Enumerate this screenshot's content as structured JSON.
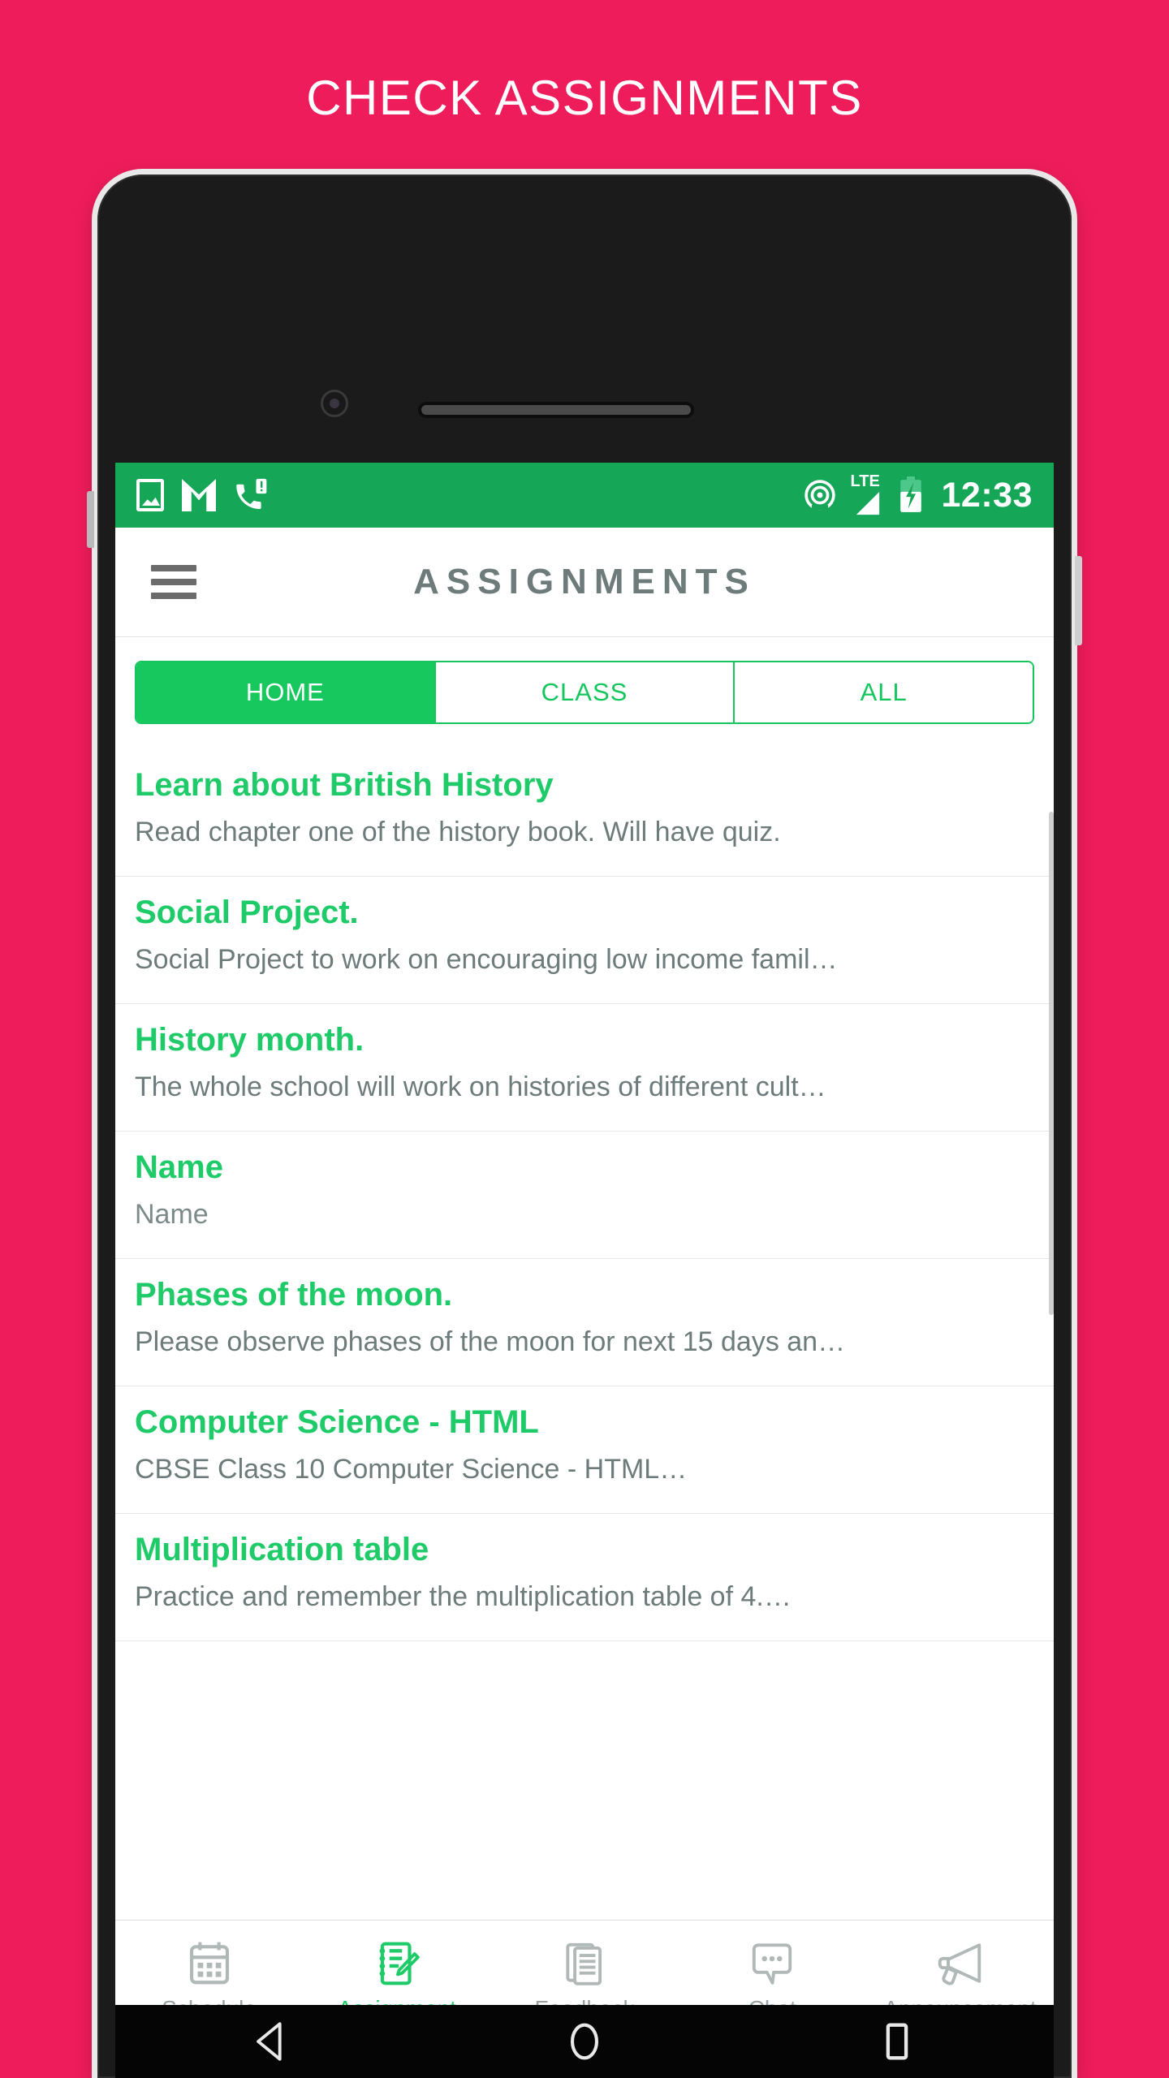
{
  "promo": {
    "headline": "CHECK ASSIGNMENTS",
    "background_color": "#EE1C5B"
  },
  "theme": {
    "status_bar_green": "#15A657",
    "accent_green": "#1ECB68",
    "muted_text": "#6d7b7b"
  },
  "status_bar": {
    "clock": "12:33",
    "network_label": "LTE",
    "left_icons": [
      "image-icon",
      "gmail-icon",
      "missed-call-icon"
    ],
    "right_icons": [
      "hotspot-icon",
      "lte-signal-icon",
      "battery-charging-icon"
    ]
  },
  "app_bar": {
    "title": "ASSIGNMENTS",
    "menu_icon": "hamburger-menu-icon"
  },
  "segmented_tabs": {
    "active": "HOME",
    "items": [
      {
        "label": "HOME",
        "active": true
      },
      {
        "label": "CLASS",
        "active": false
      },
      {
        "label": "ALL",
        "active": false
      }
    ]
  },
  "assignments": [
    {
      "title": "Learn about British History",
      "subtitle": "Read chapter one of the history book. Will have quiz."
    },
    {
      "title": "Social Project.",
      "subtitle": "Social Project to work on encouraging low income famil…"
    },
    {
      "title": "History month.",
      "subtitle": "The whole school will work on histories of different cult…"
    },
    {
      "title": "Name",
      "subtitle": "Name"
    },
    {
      "title": "Phases of the moon.",
      "subtitle": "Please observe phases of the moon for next 15 days an…"
    },
    {
      "title": "Computer Science - HTML",
      "subtitle": "CBSE Class 10 Computer Science - HTML…"
    },
    {
      "title": "Multiplication table",
      "subtitle": "Practice and remember the multiplication table of 4.…"
    }
  ],
  "bottom_nav": {
    "active": "Assignment",
    "items": [
      {
        "label": "Schedule",
        "icon": "calendar-icon",
        "active": false
      },
      {
        "label": "Assignment",
        "icon": "notepad-pencil-icon",
        "active": true
      },
      {
        "label": "Feedback",
        "icon": "documents-icon",
        "active": false
      },
      {
        "label": "Chat",
        "icon": "speech-bubble-icon",
        "active": false
      },
      {
        "label": "Announcement",
        "icon": "megaphone-icon",
        "active": false
      }
    ]
  },
  "android_nav": {
    "back": "back-triangle-icon",
    "home": "home-circle-icon",
    "recents": "recents-square-icon"
  }
}
